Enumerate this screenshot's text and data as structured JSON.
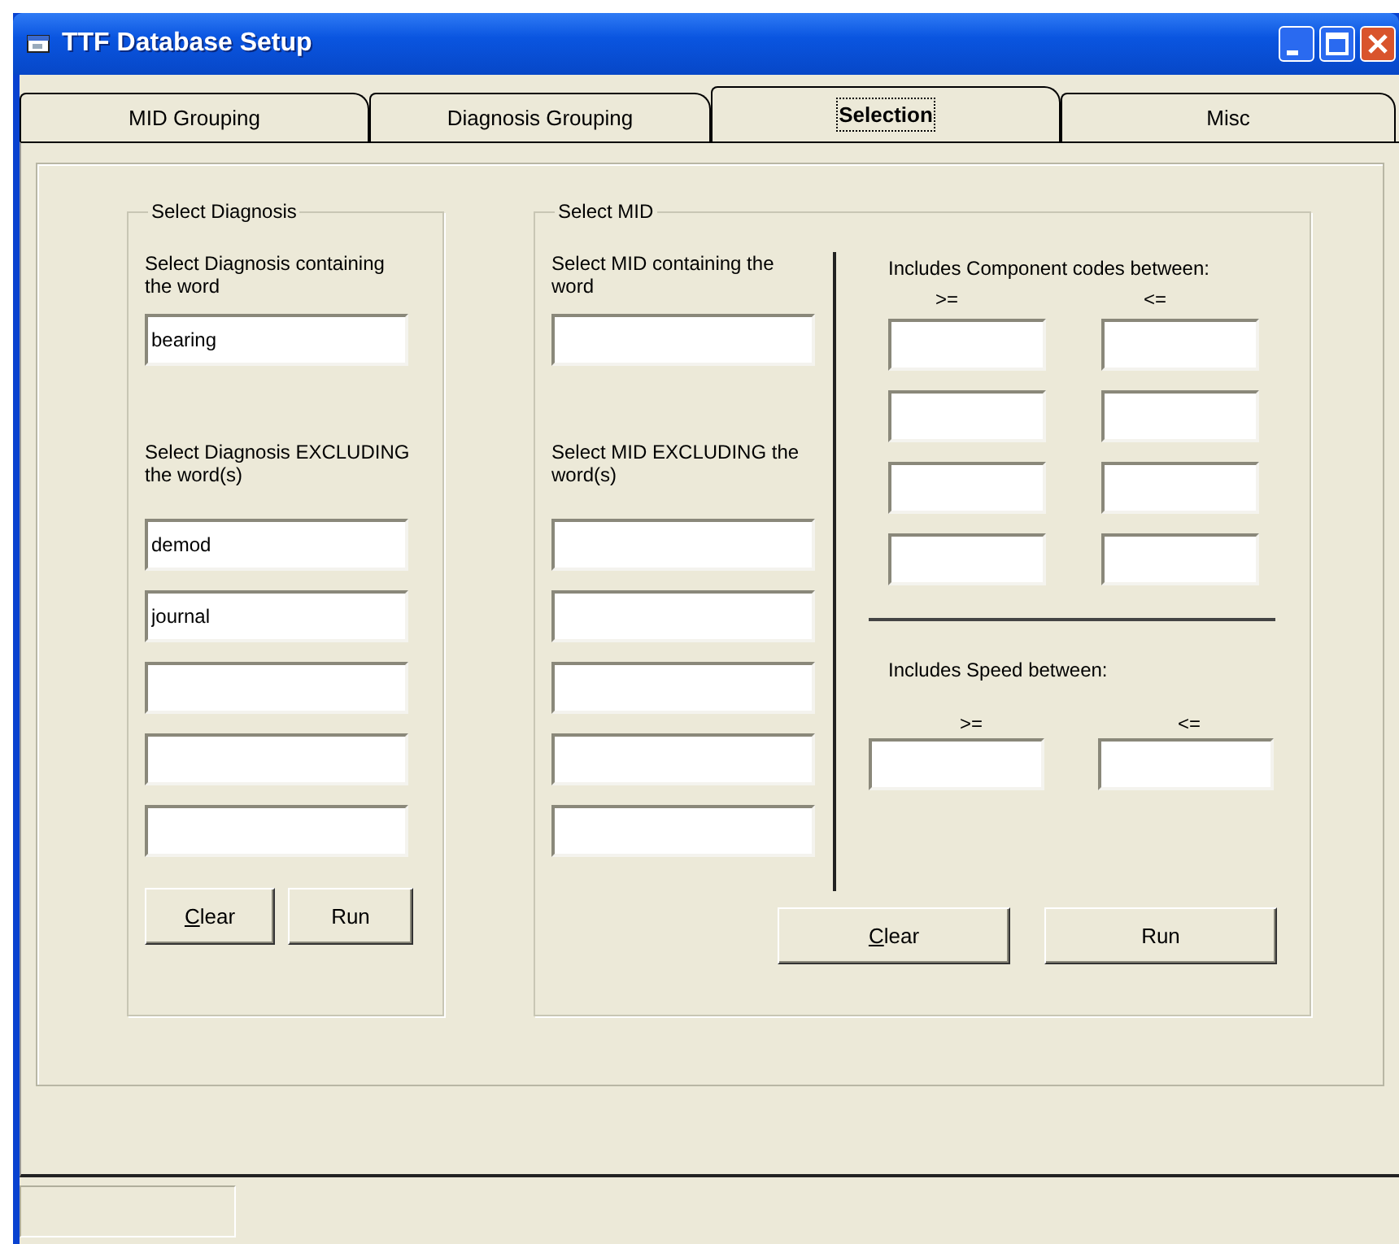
{
  "window": {
    "title": "TTF Database Setup",
    "controls": [
      {
        "kind": "minimize"
      },
      {
        "kind": "maximize"
      },
      {
        "kind": "close"
      }
    ]
  },
  "tabs": [
    {
      "label": "MID Grouping",
      "selected": false
    },
    {
      "label": "Diagnosis Grouping",
      "selected": false
    },
    {
      "label": "Selection",
      "selected": true
    },
    {
      "label": "Misc",
      "selected": false
    }
  ],
  "diagnosis_group": {
    "title": "Select Diagnosis",
    "include_label": "Select Diagnosis containing the word",
    "include_fields": [
      {
        "kind": "text_box",
        "value": "bearing"
      }
    ],
    "exclude_label": "Select Diagnosis EXCLUDING the word(s)",
    "exclude_fields": [
      {
        "kind": "text_box",
        "value": "demod"
      },
      {
        "kind": "text_box",
        "value": "journal"
      },
      {
        "kind": "text_box"
      },
      {
        "kind": "text_box"
      },
      {
        "kind": "text_box"
      }
    ],
    "buttons": [
      {
        "label_parts": [
          {
            "text": "C",
            "underlined": true
          },
          {
            "text": "lear",
            "underlined": false
          }
        ]
      },
      {
        "label_parts": [
          {
            "text": "Run",
            "underlined": false
          }
        ]
      }
    ]
  },
  "mid_group": {
    "title": "Select MID",
    "include_label": "Select MID containing the word",
    "include_fields": [
      {
        "kind": "text_box"
      }
    ],
    "exclude_label": "Select MID EXCLUDING the word(s)",
    "exclude_fields": [
      {
        "kind": "text_box"
      },
      {
        "kind": "text_box"
      },
      {
        "kind": "text_box"
      },
      {
        "kind": "text_box"
      },
      {
        "kind": "text_box"
      }
    ],
    "component_label": "Includes Component codes between:",
    "component_min_label": ">=",
    "component_max_label": "<=",
    "component_rows": [
      {
        "kind": "text_box_pair"
      },
      {
        "kind": "text_box_pair"
      },
      {
        "kind": "text_box_pair"
      },
      {
        "kind": "text_box_pair"
      }
    ],
    "speed_label": "Includes Speed between:",
    "speed_min_label": ">=",
    "speed_max_label": "<=",
    "buttons": [
      {
        "label_parts": [
          {
            "text": "C",
            "underlined": true
          },
          {
            "text": "lear",
            "underlined": false
          }
        ]
      },
      {
        "label_parts": [
          {
            "text": "Run",
            "underlined": false
          }
        ]
      }
    ]
  }
}
